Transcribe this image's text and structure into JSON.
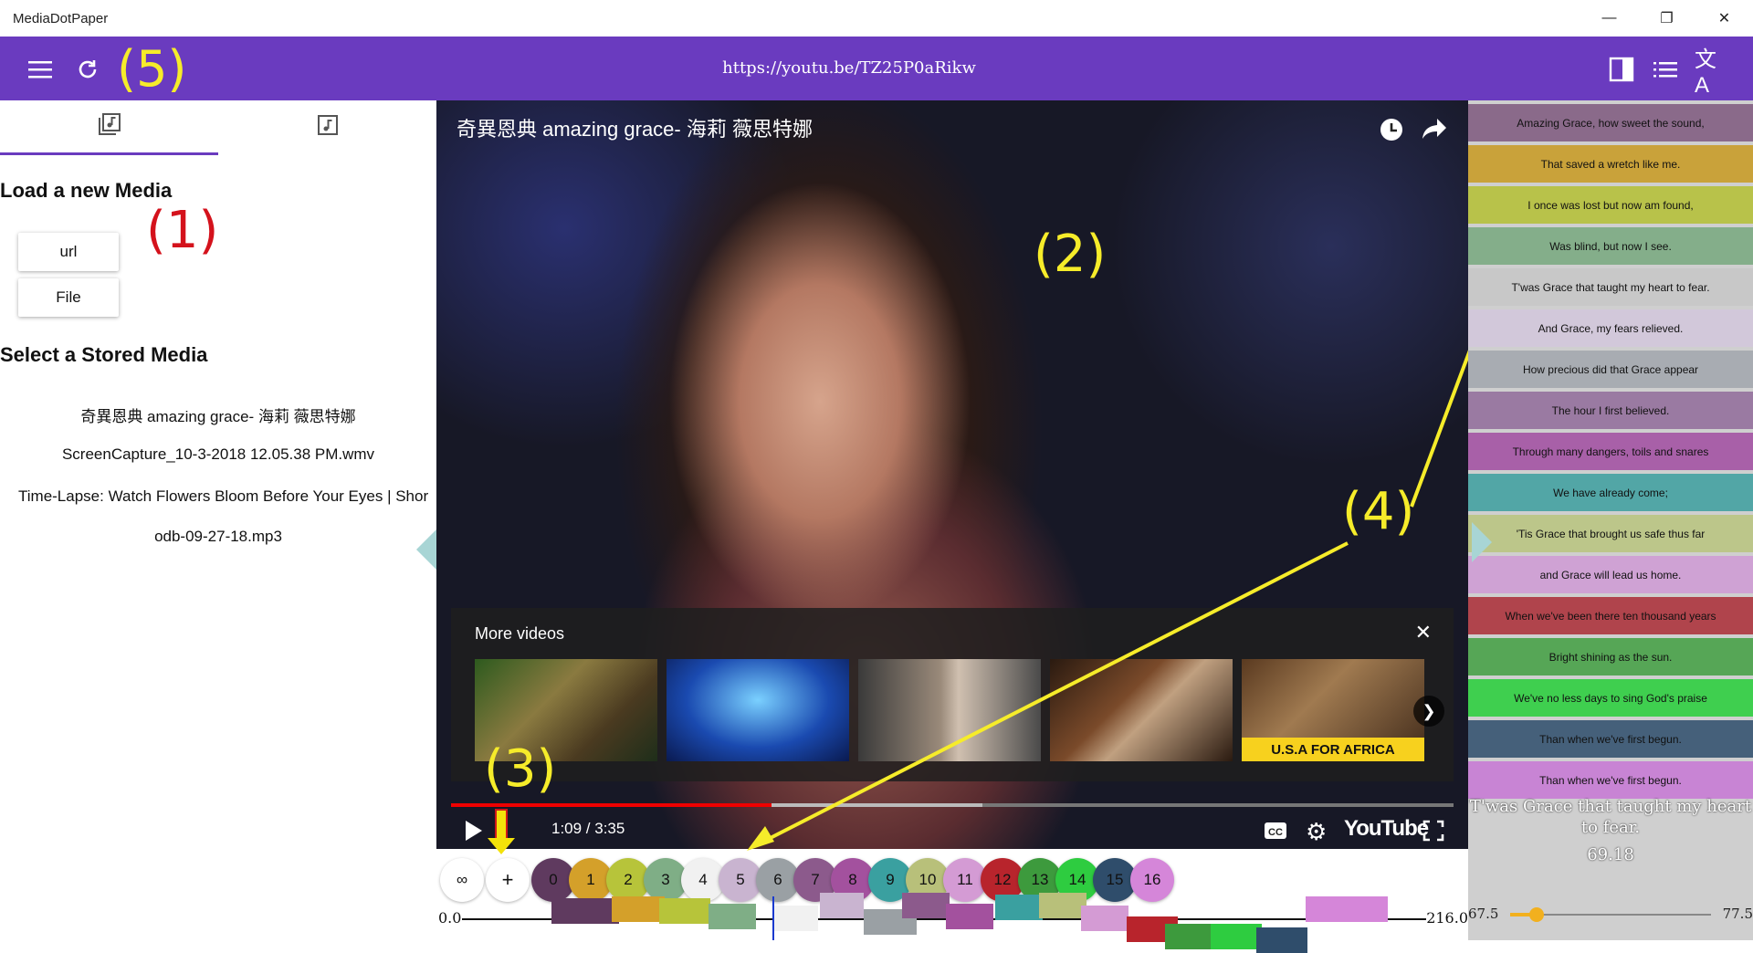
{
  "window": {
    "title": "MediaDotPaper"
  },
  "appbar": {
    "url": "https://youtu.be/TZ25P0aRikw"
  },
  "annotations": {
    "n1": "(1)",
    "n2": "(2)",
    "n3": "(3)",
    "n4": "(4)",
    "n5": "(5)"
  },
  "left": {
    "load_heading": "Load a new Media",
    "url_button": "url",
    "file_button": "File",
    "stored_heading": "Select a Stored Media",
    "stored": [
      "奇異恩典 amazing grace- 海莉 薇思特娜",
      "ScreenCapture_10-3-2018 12.05.38 PM.wmv",
      "Time-Lapse: Watch Flowers Bloom Before Your Eyes | Shor",
      "odb-09-27-18.mp3"
    ]
  },
  "video": {
    "title": "奇異恩典 amazing grace- 海莉 薇思特娜",
    "more_videos": "More videos",
    "thumb_caption": "U.S.A FOR AFRICA",
    "time": "1:09 / 3:35",
    "progress_fraction": 0.32,
    "buffered_fraction": 0.53,
    "youtube": "YouTube"
  },
  "segments_bar": {
    "loop_icon": "infinity-icon",
    "add": "+",
    "labels": [
      "0",
      "1",
      "2",
      "3",
      "4",
      "5",
      "6",
      "7",
      "8",
      "9",
      "10",
      "11",
      "12",
      "13",
      "14",
      "15",
      "16"
    ],
    "colors": [
      "#5f3a5f",
      "#d4a02a",
      "#b7c43a",
      "#7fae86",
      "#f1f1f1",
      "#c9b4d0",
      "#9aa0a4",
      "#8c5a8c",
      "#a3519e",
      "#3aa0a0",
      "#b8c07a",
      "#d49bd4",
      "#b8242c",
      "#3d9a3d",
      "#2ecc40",
      "#2f4d6b",
      "#d586d9"
    ],
    "timeline_start": "0.0",
    "timeline_end": "216.0"
  },
  "lyrics": {
    "lines": [
      {
        "text": "Amazing Grace, how sweet the sound,",
        "color": "#8a6a8a"
      },
      {
        "text": "That saved a wretch like me.",
        "color": "#c9a23a"
      },
      {
        "text": "I once was lost but now am found,",
        "color": "#b8c24a"
      },
      {
        "text": "Was blind, but now I see.",
        "color": "#84ae8a"
      },
      {
        "text": "T'was Grace that taught my heart to fear.",
        "color": "#c8c8c8"
      },
      {
        "text": "And Grace, my fears relieved.",
        "color": "#d2c8da"
      },
      {
        "text": "How precious did that Grace appear",
        "color": "#a8acb2"
      },
      {
        "text": "The hour I first believed.",
        "color": "#9a7aa2"
      },
      {
        "text": "Through many dangers, toils and snares",
        "color": "#a860a8"
      },
      {
        "text": "We have already come;",
        "color": "#52a6a6"
      },
      {
        "text": "'Tis Grace that brought us safe thus far",
        "color": "#bcc68a"
      },
      {
        "text": "and Grace will lead us home.",
        "color": "#cfa2d4"
      },
      {
        "text": "When we've been there ten thousand years",
        "color": "#b0444c"
      },
      {
        "text": "Bright shining as the sun.",
        "color": "#56a656"
      },
      {
        "text": "We've no less days to sing God's praise",
        "color": "#3fcf4f"
      },
      {
        "text": "Than when we've first begun.",
        "color": "#45607a"
      },
      {
        "text": "Than when we've first begun.",
        "color": "#c884d4"
      }
    ],
    "current_text": "T'was Grace that taught my heart to fear.",
    "current_time": "69.18",
    "slider_min": "67.5",
    "slider_max": "77.5",
    "slider_fraction": 0.13
  }
}
